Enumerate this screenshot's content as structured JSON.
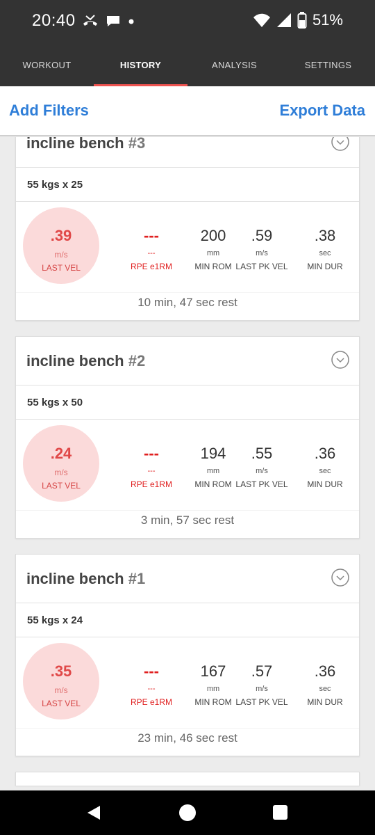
{
  "status": {
    "time": "20:40",
    "battery": "51%"
  },
  "tabs": [
    {
      "label": "WORKOUT"
    },
    {
      "label": "HISTORY"
    },
    {
      "label": "ANALYSIS"
    },
    {
      "label": "SETTINGS"
    }
  ],
  "toolbar": {
    "add_filters": "Add Filters",
    "export_data": "Export Data"
  },
  "cards": [
    {
      "title": "incline bench",
      "number": "#3",
      "set": "55 kgs x 25",
      "last_vel": {
        "value": ".39",
        "unit": "m/s",
        "label": "LAST VEL"
      },
      "rpe": {
        "value": "---",
        "unit": "---",
        "label": "RPE e1RM"
      },
      "min_rom": {
        "value": "200",
        "unit": "mm",
        "label": "MIN ROM"
      },
      "last_pk_vel": {
        "value": ".59",
        "unit": "m/s",
        "label": "LAST PK VEL"
      },
      "min_dur": {
        "value": ".38",
        "unit": "sec",
        "label": "MIN DUR"
      },
      "rest": "10 min, 47 sec rest"
    },
    {
      "title": "incline bench",
      "number": "#2",
      "set": "55 kgs x 50",
      "last_vel": {
        "value": ".24",
        "unit": "m/s",
        "label": "LAST VEL"
      },
      "rpe": {
        "value": "---",
        "unit": "---",
        "label": "RPE e1RM"
      },
      "min_rom": {
        "value": "194",
        "unit": "mm",
        "label": "MIN ROM"
      },
      "last_pk_vel": {
        "value": ".55",
        "unit": "m/s",
        "label": "LAST PK VEL"
      },
      "min_dur": {
        "value": ".36",
        "unit": "sec",
        "label": "MIN DUR"
      },
      "rest": "3 min, 57 sec rest"
    },
    {
      "title": "incline bench",
      "number": "#1",
      "set": "55 kgs x 24",
      "last_vel": {
        "value": ".35",
        "unit": "m/s",
        "label": "LAST VEL"
      },
      "rpe": {
        "value": "---",
        "unit": "---",
        "label": "RPE e1RM"
      },
      "min_rom": {
        "value": "167",
        "unit": "mm",
        "label": "MIN ROM"
      },
      "last_pk_vel": {
        "value": ".57",
        "unit": "m/s",
        "label": "LAST PK VEL"
      },
      "min_dur": {
        "value": ".36",
        "unit": "sec",
        "label": "MIN DUR"
      },
      "rest": "23 min, 46 sec rest"
    }
  ]
}
